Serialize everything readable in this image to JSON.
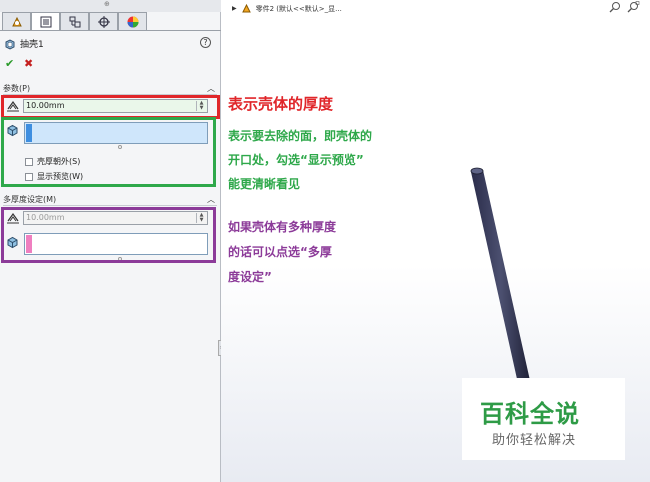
{
  "panel": {
    "tabs": [
      "feature-manager",
      "property-manager",
      "configuration-manager",
      "dimxpert-manager",
      "display-manager"
    ],
    "feature_title": "抽壳1",
    "help_label": "?",
    "ok_label": "✔",
    "cancel_label": "✖",
    "params": {
      "header": "参数(P)",
      "thickness_value": "10.00mm",
      "reverse_label": "壳厚朝外(S)",
      "preview_label": "显示预览(W)"
    },
    "multi": {
      "header": "多厚度设定(M)",
      "thickness_placeholder": "10.00mm"
    }
  },
  "viewport": {
    "breadcrumb": "零件2 (默认<<默认>_显..."
  },
  "annotations": {
    "red_text": "表示壳体的厚度",
    "green_lines": [
      "表示要去除的面，即壳体的",
      "开口处，勾选“显示预览”",
      "能更清晰看见"
    ],
    "purple_lines": [
      "如果壳体有多种厚度",
      "的话可以点选“多厚",
      "度设定”"
    ],
    "colors": {
      "red": "#e0262a",
      "green": "#2ea84a",
      "purple": "#8c3b99"
    }
  },
  "watermark": {
    "title": "百科全说",
    "subtitle": "助你轻松解决"
  }
}
